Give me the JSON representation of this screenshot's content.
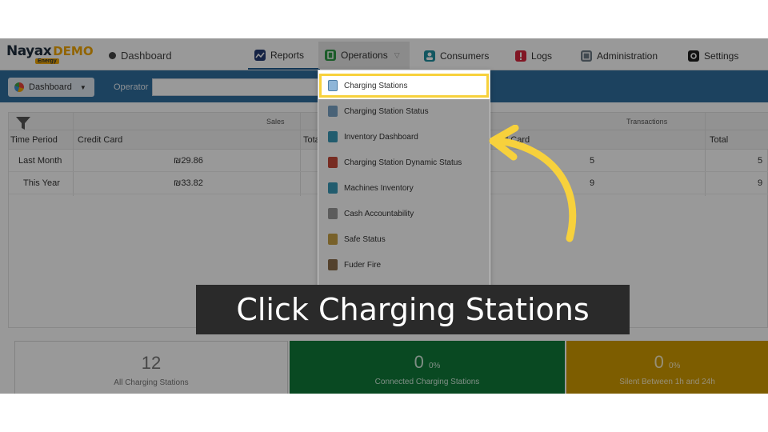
{
  "logo": {
    "brand": "Nayax",
    "demo": "DEMO",
    "sub": "Energy"
  },
  "breadcrumb": "Dashboard",
  "nav": [
    {
      "label": "Reports"
    },
    {
      "label": "Operations"
    },
    {
      "label": "Consumers"
    },
    {
      "label": "Logs"
    },
    {
      "label": "Administration"
    },
    {
      "label": "Settings"
    }
  ],
  "toolbar": {
    "dashboard_label": "Dashboard",
    "operator_label": "Operator",
    "operator_value": ""
  },
  "table": {
    "groups": {
      "sales": "Sales",
      "transactions": "Transactions"
    },
    "columns": [
      "Time Period",
      "Credit Card",
      "Tota",
      "ed Card",
      "Total"
    ],
    "rows": [
      {
        "period": "Last Month",
        "credit": "₪29.86",
        "tx_card": "5",
        "tx_total": "5"
      },
      {
        "period": "This Year",
        "credit": "₪33.82",
        "tx_card": "9",
        "tx_total": "9"
      }
    ]
  },
  "tiles": [
    {
      "value": "12",
      "pct": "",
      "label": "All Charging Stations"
    },
    {
      "value": "0",
      "pct": "0%",
      "label": "Connected Charging Stations"
    },
    {
      "value": "0",
      "pct": "0%",
      "label": "Silent Between 1h and 24h"
    }
  ],
  "menu": {
    "items": [
      {
        "label": "Charging Stations"
      },
      {
        "label": "Charging Station Status"
      },
      {
        "label": "Inventory Dashboard"
      },
      {
        "label": "Charging Station Dynamic Status"
      },
      {
        "label": "Machines Inventory"
      },
      {
        "label": "Cash Accountability"
      },
      {
        "label": "Safe Status"
      },
      {
        "label": "Fuder Fire"
      }
    ]
  },
  "callout": "Click Charging Stations",
  "colors": {
    "accent": "#f7d13c",
    "toolbar": "#2f6f9f",
    "green": "#0f7a3a",
    "amber": "#d19b00"
  }
}
